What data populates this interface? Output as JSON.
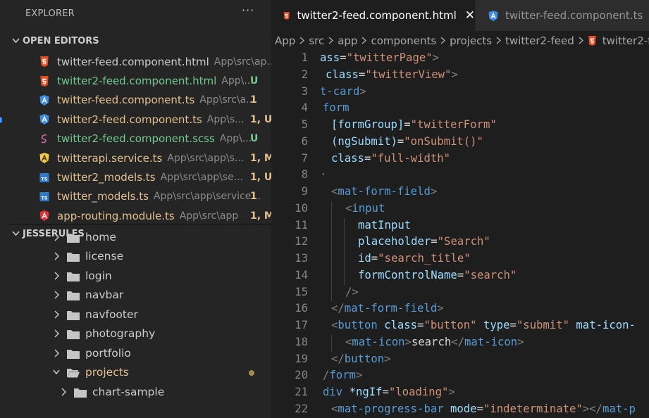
{
  "explorer": {
    "title": "EXPLORER",
    "more_label": "···"
  },
  "open_editors": {
    "header": "OPEN EDITORS",
    "items": [
      {
        "name": "twitter-feed.component.html",
        "path": "App\\src\\ap...",
        "status": "",
        "icon": "html5-icon",
        "color": "white"
      },
      {
        "name": "twitter2-feed.component.html",
        "path": "App\\...",
        "status": "U",
        "icon": "html5-icon",
        "color": "green"
      },
      {
        "name": "twitter-feed.component.ts",
        "path": "App\\src\\a...",
        "status": "1",
        "icon": "angular-icon",
        "color": "yellow"
      },
      {
        "name": "twitter2-feed.component.ts",
        "path": "App\\s...",
        "status": "1, U",
        "icon": "angular-icon",
        "color": "yellow"
      },
      {
        "name": "twitter2-feed.component.scss",
        "path": "App\\...",
        "status": "U",
        "icon": "sass-icon",
        "color": "green"
      },
      {
        "name": "twitterapi.service.ts",
        "path": "App\\src\\app\\s...",
        "status": "1, M",
        "icon": "angular-service-icon",
        "color": "yellow"
      },
      {
        "name": "twitter2_models.ts",
        "path": "App\\src\\app\\se...",
        "status": "1, U",
        "icon": "typescript-icon",
        "color": "yellow"
      },
      {
        "name": "twitter_models.ts",
        "path": "App\\src\\app\\service...",
        "status": "1",
        "icon": "typescript-icon",
        "color": "yellow"
      },
      {
        "name": "app-routing.module.ts",
        "path": "App\\src\\app",
        "status": "1, M",
        "icon": "angular-routing-icon",
        "color": "yellow"
      }
    ]
  },
  "workspace": {
    "header": "JESSERULES",
    "folders": [
      {
        "name": "home",
        "expanded": false
      },
      {
        "name": "license",
        "expanded": false
      },
      {
        "name": "login",
        "expanded": false
      },
      {
        "name": "navbar",
        "expanded": false
      },
      {
        "name": "navfooter",
        "expanded": false
      },
      {
        "name": "photography",
        "expanded": false
      },
      {
        "name": "portfolio",
        "expanded": false
      },
      {
        "name": "projects",
        "expanded": true
      },
      {
        "name": "chart-sample",
        "expanded": false
      }
    ]
  },
  "tabs": [
    {
      "label": "twitter2-feed.component.html",
      "icon": "html5-icon",
      "active": true,
      "close": "✕"
    },
    {
      "label": "twitter-feed.component.ts",
      "icon": "angular-icon",
      "active": false
    }
  ],
  "breadcrumb": [
    "App",
    "src",
    "app",
    "components",
    "projects",
    "twitter2-feed",
    "twitter2-f"
  ],
  "code_lines": [
    {
      "n": "1",
      "tokens": [
        [
          "attr",
          "ass"
        ],
        [
          "eq",
          "="
        ],
        [
          "str",
          "\"twitterPage\""
        ],
        [
          "punct",
          ">"
        ]
      ],
      "indent": 0
    },
    {
      "n": "2",
      "tokens": [
        [
          "attr",
          "class"
        ],
        [
          "eq",
          "="
        ],
        [
          "str",
          "\"twitterView\""
        ],
        [
          "punct",
          ">"
        ]
      ],
      "indent": 8
    },
    {
      "n": "3",
      "tokens": [
        [
          "tag",
          "t-card"
        ],
        [
          "punct",
          ">"
        ]
      ],
      "indent": 0
    },
    {
      "n": "4",
      "tokens": [
        [
          "tag",
          "form"
        ]
      ],
      "indent": 4
    },
    {
      "n": "5",
      "tokens": [
        [
          "attr",
          "[formGroup]"
        ],
        [
          "eq",
          "="
        ],
        [
          "str",
          "\"twitterForm\""
        ]
      ],
      "indent": 16
    },
    {
      "n": "6",
      "tokens": [
        [
          "attr",
          "(ngSubmit)"
        ],
        [
          "eq",
          "="
        ],
        [
          "str",
          "\"onSubmit()\""
        ]
      ],
      "indent": 16
    },
    {
      "n": "7",
      "tokens": [
        [
          "attr",
          "class"
        ],
        [
          "eq",
          "="
        ],
        [
          "str",
          "\"full-width\""
        ]
      ],
      "indent": 16
    },
    {
      "n": "8",
      "tokens": [
        [
          "punct",
          "·"
        ]
      ],
      "indent": 0
    },
    {
      "n": "9",
      "tokens": [
        [
          "punct",
          "<"
        ],
        [
          "tag",
          "mat-form-field"
        ],
        [
          "punct",
          ">"
        ]
      ],
      "indent": 16
    },
    {
      "n": "10",
      "tokens": [
        [
          "punct",
          "<"
        ],
        [
          "tag",
          "input"
        ]
      ],
      "indent": 36
    },
    {
      "n": "11",
      "tokens": [
        [
          "attr",
          "matInput"
        ]
      ],
      "indent": 54
    },
    {
      "n": "12",
      "tokens": [
        [
          "attr",
          "placeholder"
        ],
        [
          "eq",
          "="
        ],
        [
          "str",
          "\"Search\""
        ]
      ],
      "indent": 54
    },
    {
      "n": "13",
      "tokens": [
        [
          "attr",
          "id"
        ],
        [
          "eq",
          "="
        ],
        [
          "str",
          "\"search_title\""
        ]
      ],
      "indent": 54
    },
    {
      "n": "14",
      "tokens": [
        [
          "attr",
          "formControlName"
        ],
        [
          "eq",
          "="
        ],
        [
          "str",
          "\"search\""
        ]
      ],
      "indent": 54
    },
    {
      "n": "15",
      "tokens": [
        [
          "punct",
          "/>"
        ]
      ],
      "indent": 36
    },
    {
      "n": "16",
      "tokens": [
        [
          "punct",
          "</"
        ],
        [
          "tag",
          "mat-form-field"
        ],
        [
          "punct",
          ">"
        ]
      ],
      "indent": 16
    },
    {
      "n": "17",
      "tokens": [
        [
          "punct",
          "<"
        ],
        [
          "tag",
          "button"
        ],
        [
          "text",
          " "
        ],
        [
          "attr",
          "class"
        ],
        [
          "eq",
          "="
        ],
        [
          "str",
          "\"button\""
        ],
        [
          "text",
          " "
        ],
        [
          "attr",
          "type"
        ],
        [
          "eq",
          "="
        ],
        [
          "str",
          "\"submit\""
        ],
        [
          "text",
          " "
        ],
        [
          "attr",
          "mat-icon-"
        ]
      ],
      "indent": 16
    },
    {
      "n": "18",
      "tokens": [
        [
          "punct",
          "<"
        ],
        [
          "tag",
          "mat-icon"
        ],
        [
          "punct",
          ">"
        ],
        [
          "text",
          "search"
        ],
        [
          "punct",
          "</"
        ],
        [
          "tag",
          "mat-icon"
        ],
        [
          "punct",
          ">"
        ]
      ],
      "indent": 36
    },
    {
      "n": "19",
      "tokens": [
        [
          "punct",
          "</"
        ],
        [
          "tag",
          "button"
        ],
        [
          "punct",
          ">"
        ]
      ],
      "indent": 16
    },
    {
      "n": "20",
      "tokens": [
        [
          "punct",
          "/"
        ],
        [
          "tag",
          "form"
        ],
        [
          "punct",
          ">"
        ]
      ],
      "indent": 4
    },
    {
      "n": "21",
      "tokens": [
        [
          "tag",
          "div"
        ],
        [
          "text",
          " "
        ],
        [
          "attr",
          "*ngIf"
        ],
        [
          "eq",
          "="
        ],
        [
          "str",
          "\"loading\""
        ],
        [
          "punct",
          ">"
        ]
      ],
      "indent": 4
    },
    {
      "n": "22",
      "tokens": [
        [
          "punct",
          "<"
        ],
        [
          "tag",
          "mat-progress-bar"
        ],
        [
          "text",
          " "
        ],
        [
          "attr",
          "mode"
        ],
        [
          "eq",
          "="
        ],
        [
          "str",
          "\"indeterminate\""
        ],
        [
          "punct",
          "></"
        ],
        [
          "tag",
          "mat-p"
        ]
      ],
      "indent": 16
    }
  ],
  "colors": {
    "html5": "#e44d26",
    "angular": "#3c8de2",
    "angular_service": "#f2c94c",
    "angular_routing": "#e23237",
    "typescript": "#3178c6",
    "sass": "#cd6799",
    "folder": "#c5c5c5"
  }
}
